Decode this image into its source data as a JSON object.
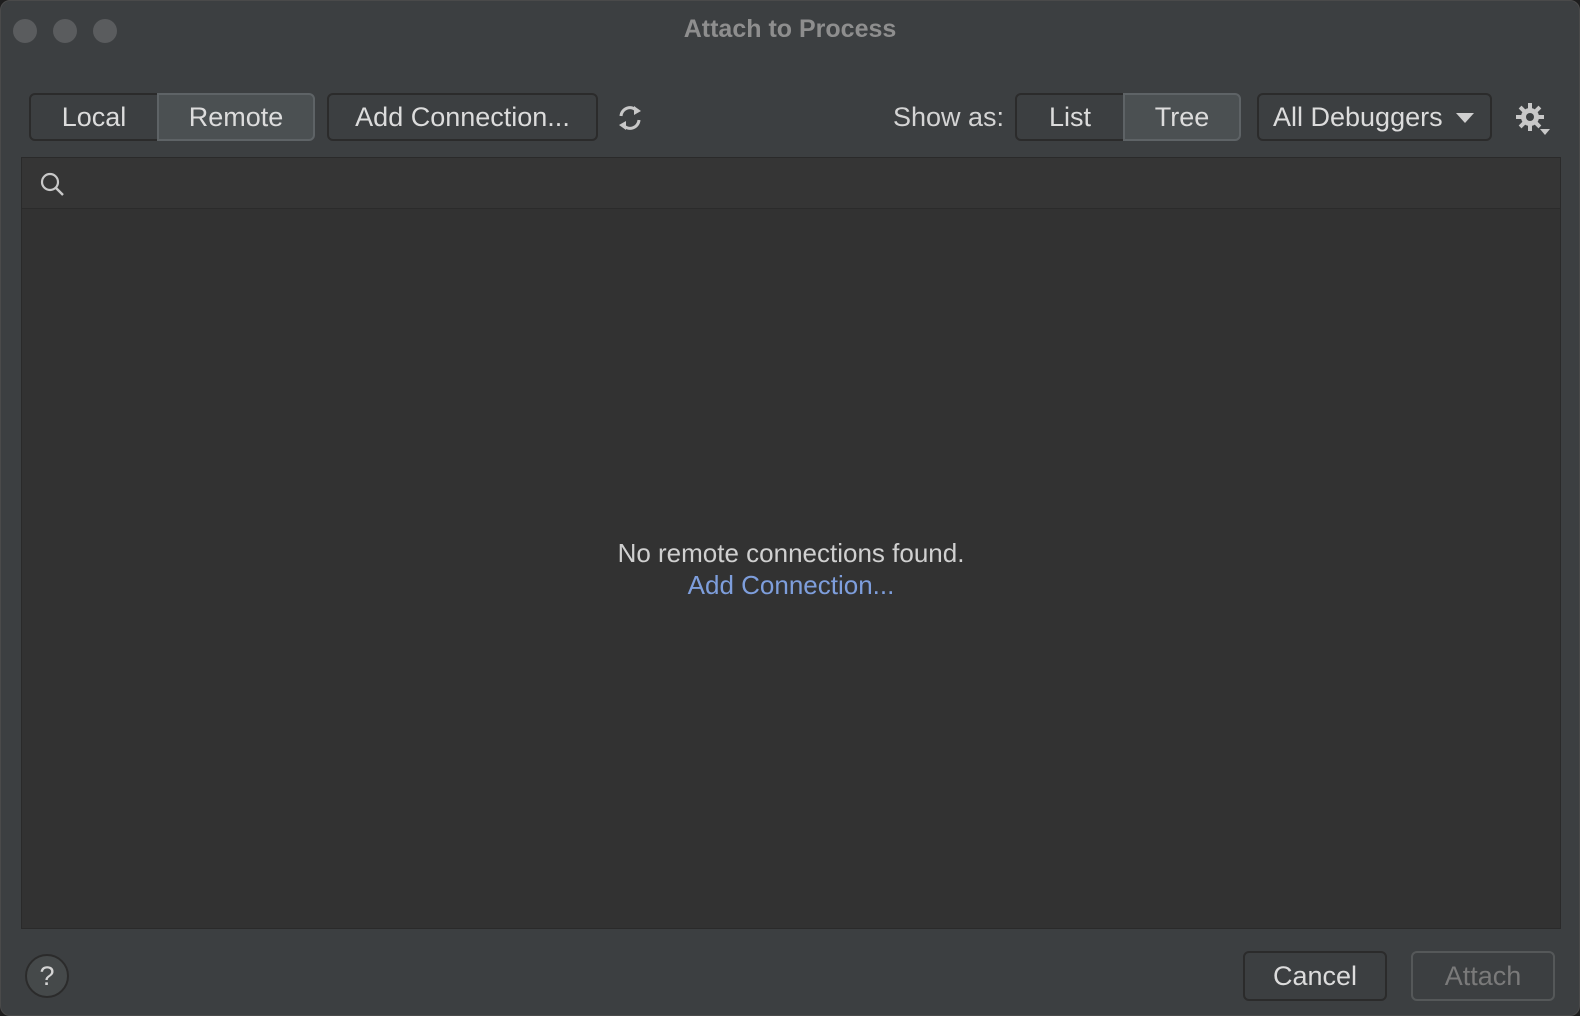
{
  "window": {
    "title": "Attach to Process"
  },
  "toolbar": {
    "mode_tabs": [
      {
        "label": "Local",
        "selected": false
      },
      {
        "label": "Remote",
        "selected": true
      }
    ],
    "add_connection_label": "Add Connection...",
    "refresh_icon": "refresh-icon",
    "show_as_label": "Show as:",
    "view_tabs": [
      {
        "label": "List",
        "selected": false
      },
      {
        "label": "Tree",
        "selected": true
      }
    ],
    "debugger_select": {
      "value": "All Debuggers"
    },
    "settings_icon": "gear-icon"
  },
  "search": {
    "placeholder": "",
    "value": "",
    "icon": "search-icon"
  },
  "empty_state": {
    "message": "No remote connections found.",
    "link_label": "Add Connection..."
  },
  "footer": {
    "help_label": "?",
    "cancel_label": "Cancel",
    "attach_label": "Attach",
    "attach_enabled": false
  },
  "colors": {
    "window_bg": "#3c3f41",
    "panel_bg": "#323232",
    "link": "#7e9edc",
    "text": "#dcdcdc",
    "disabled_text": "#7a7a7a"
  }
}
